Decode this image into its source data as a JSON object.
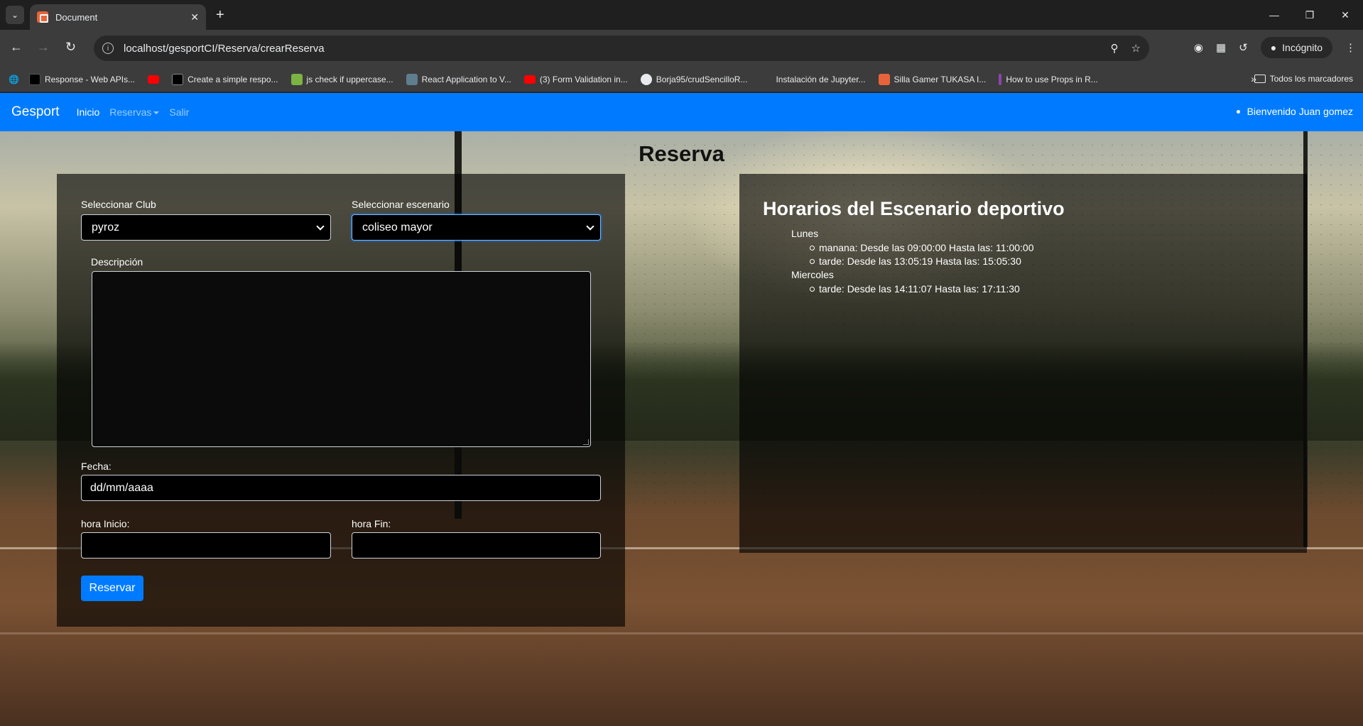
{
  "browser": {
    "tab_title": "Document",
    "url": "localhost/gesportCI/Reserva/crearReserva",
    "incognito_label": "Incógnito",
    "all_bookmarks_label": "Todos los marcadores",
    "bookmarks": [
      {
        "label": "Response - Web APIs...",
        "icon": "mdn-icon",
        "color": "#000000"
      },
      {
        "label": "",
        "icon": "youtube-icon",
        "color": "#ff0000"
      },
      {
        "label": "Create a simple respo...",
        "icon": "medium-icon",
        "color": "#000000"
      },
      {
        "label": "js check if uppercase...",
        "icon": "grepper-icon",
        "color": "#7cb342"
      },
      {
        "label": "React Application to V...",
        "icon": "page-icon",
        "color": "#5f7d8c"
      },
      {
        "label": "(3) Form Validation in...",
        "icon": "youtube-icon",
        "color": "#ff0000"
      },
      {
        "label": "Borja95/crudSencilloR...",
        "icon": "github-icon",
        "color": "#e8eaed"
      },
      {
        "label": "Instalación de Jupyter...",
        "icon": "blank-icon",
        "color": "#3c3c3c"
      },
      {
        "label": "Silla Gamer TUKASA I...",
        "icon": "k-icon",
        "color": "#e8633a"
      },
      {
        "label": "How to use Props in R...",
        "icon": "devto-icon",
        "color": "#8e44ad"
      }
    ]
  },
  "navbar": {
    "brand": "Gesport",
    "links": {
      "inicio": "Inicio",
      "reservas": "Reservas",
      "salir": "Salir"
    },
    "welcome": "Bienvenido Juan gomez",
    "color": "#007bff"
  },
  "page": {
    "title": "Reserva"
  },
  "form": {
    "club_label": "Seleccionar Club",
    "club_value": "pyroz",
    "escenario_label": "Seleccionar escenario",
    "escenario_value": "coliseo mayor",
    "descripcion_label": "Descripción",
    "descripcion_value": "",
    "fecha_label": "Fecha:",
    "fecha_placeholder": "dd/mm/aaaa",
    "hora_inicio_label": "hora Inicio:",
    "hora_fin_label": "hora Fin:",
    "submit_label": "Reservar"
  },
  "schedule": {
    "title": "Horarios del Escenario deportivo",
    "days": [
      {
        "day": "Lunes",
        "slots": [
          "manana: Desde las 09:00:00 Hasta las: 11:00:00",
          "tarde: Desde las 13:05:19 Hasta las: 15:05:30"
        ]
      },
      {
        "day": "Miercoles",
        "slots": [
          "tarde: Desde las 14:11:07 Hasta las: 17:11:30"
        ]
      }
    ]
  }
}
